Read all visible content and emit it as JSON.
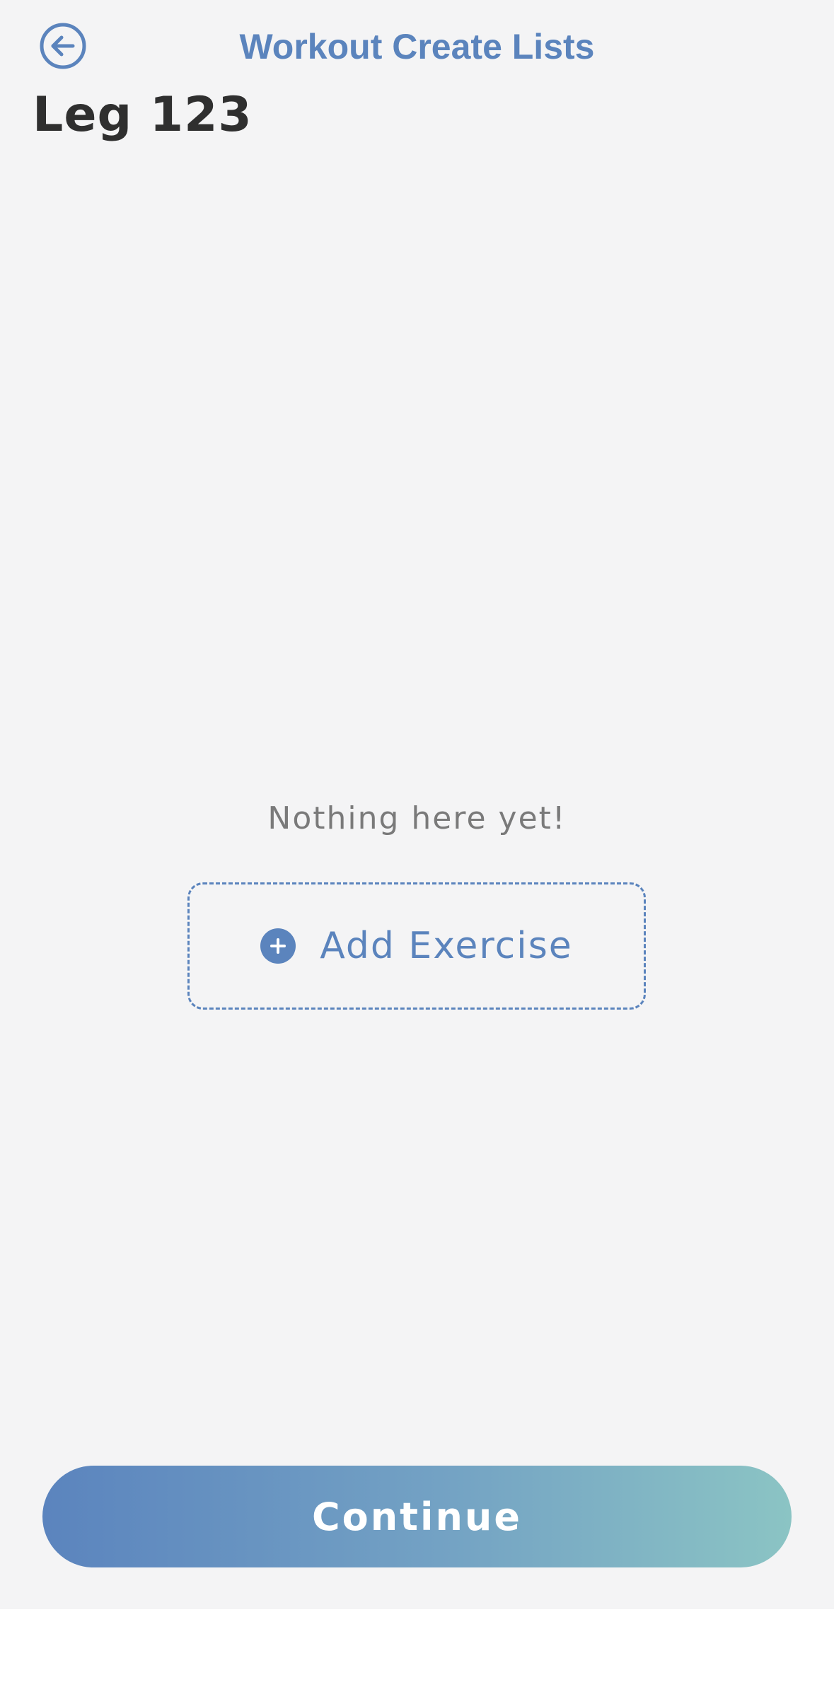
{
  "header": {
    "back_icon": "arrow-left-circle-icon",
    "title": "Workout Create Lists"
  },
  "workout": {
    "name": "Leg 123"
  },
  "empty_state": {
    "message": "Nothing here yet!",
    "add_icon": "plus-circle-icon",
    "add_label": "Add Exercise"
  },
  "footer": {
    "continue_label": "Continue"
  },
  "colors": {
    "accent": "#5b84bd",
    "background": "#f4f4f5",
    "title_text": "#2f2f2f",
    "muted_text": "#7a7a7a",
    "gradient_start": "#5b84be",
    "gradient_end": "#8bc4c4"
  }
}
